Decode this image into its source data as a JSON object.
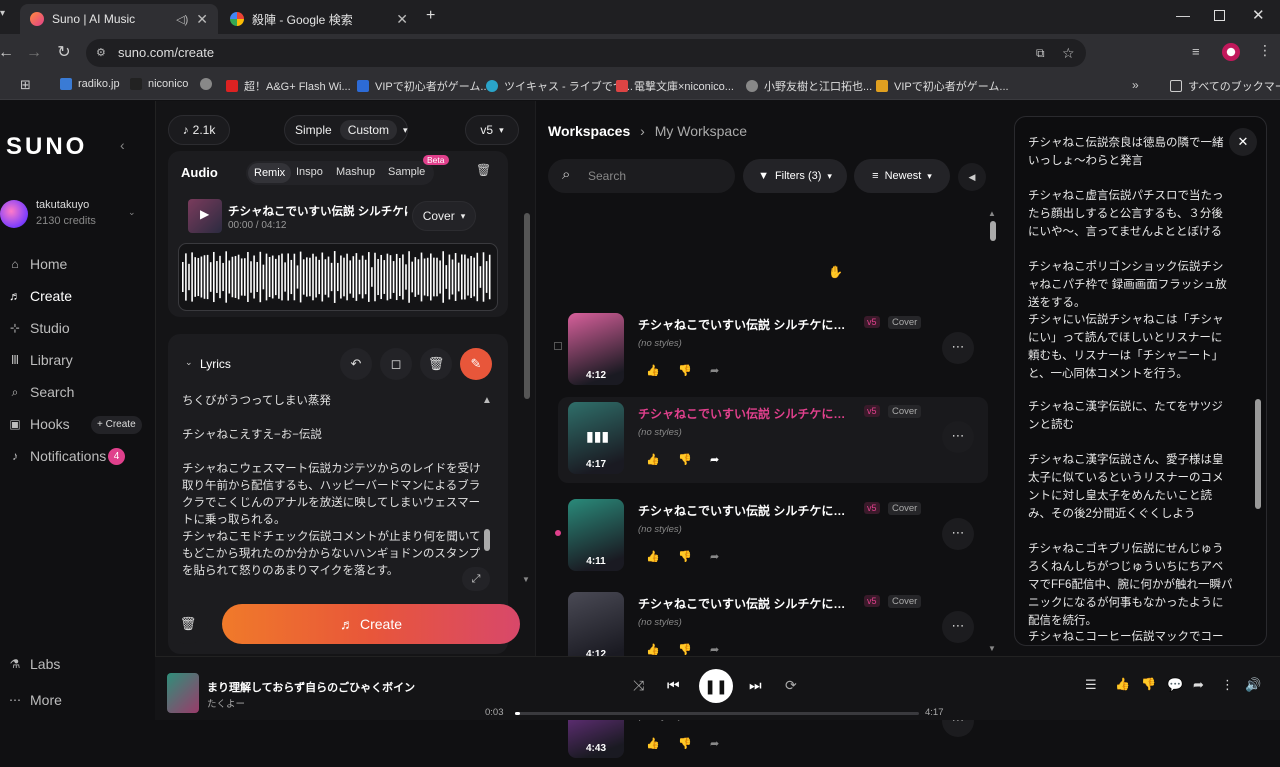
{
  "browser": {
    "tabs": [
      {
        "title": "Suno | AI Music",
        "active": true
      },
      {
        "title": "殺陣 - Google 検索",
        "active": false
      }
    ],
    "url": "suno.com/create",
    "bookmarks": [
      "radiko.jp",
      "niconico",
      "超！A&G+ Flash Wi...",
      "VIPで初心者がゲーム...",
      "ツイキャス - ライブでつ...",
      "電撃文庫×niconico...",
      "小野友樹と江口拓也...",
      "VIPで初心者がゲーム..."
    ],
    "bookmarks_folder": "すべてのブックマーク"
  },
  "sidebar": {
    "logo": "SUNO",
    "user": {
      "name": "takutakuyo",
      "credits": "2130 credits"
    },
    "items": [
      {
        "label": "Home",
        "icon": "home-icon"
      },
      {
        "label": "Create",
        "icon": "create-icon",
        "active": true
      },
      {
        "label": "Studio",
        "icon": "studio-icon"
      },
      {
        "label": "Library",
        "icon": "library-icon"
      },
      {
        "label": "Search",
        "icon": "search-icon"
      },
      {
        "label": "Hooks",
        "icon": "hooks-icon"
      },
      {
        "label": "Notifications",
        "icon": "bell-icon"
      }
    ],
    "hooks_create": "+ Create",
    "notifications_badge": "4",
    "bottom": [
      {
        "label": "Labs",
        "icon": "labs-icon"
      },
      {
        "label": "More",
        "icon": "more-icon"
      }
    ]
  },
  "create_panel": {
    "count": "2.1k",
    "mode_simple": "Simple",
    "mode_custom": "Custom",
    "model": "v5",
    "audio_label": "Audio",
    "audio_tabs": [
      "Remix",
      "Inspo",
      "Mashup",
      "Sample"
    ],
    "beta": "Beta",
    "track_title": "チシャねこでいすい伝説 シルチケにつ...",
    "track_time": "00:00 / 04:12",
    "cover_label": "Cover",
    "lyrics_label": "Lyrics",
    "lyrics_lines": [
      "ちくびがうつってしまい蒸発",
      "チシャねこえすえ−お−伝説",
      "チシャねこウェスマート伝説カジテツからのレイドを受け取り午前から配信するも、ハッピーバードマンによるブラクラでこくじんのアナルを放送に映してしまいウェスマートに乗っ取られる。",
      "チシャねこモドチェック伝説コメントが止まり何を聞いてもどこから現れたのか分からないハンギョドンのスタンプを貼られて怒りのあまりマイクを落とす。"
    ],
    "create_button": "Create"
  },
  "workspace": {
    "breadcrumb_root": "Workspaces",
    "breadcrumb_current": "My Workspace",
    "search_placeholder": "Search",
    "filters": "Filters (3)",
    "sort": "Newest",
    "songs": [
      {
        "title": "チシャねこでいすい伝説 シルチケについてあま...",
        "version": "v5",
        "type": "Cover",
        "styles": "(no styles)",
        "duration": "4:12",
        "color": "#d7609b",
        "highlight": false
      },
      {
        "title": "チシャねこでいすい伝説 シルチケについてあ...",
        "version": "v5",
        "type": "Cover",
        "styles": "(no styles)",
        "duration": "4:17",
        "color": "#2f6f6a",
        "highlight": true
      },
      {
        "title": "チシャねこでいすい伝説 シルチケについてあま...",
        "version": "v5",
        "type": "Cover",
        "styles": "(no styles)",
        "duration": "4:11",
        "color": "#2a8a7a",
        "highlight": false
      },
      {
        "title": "チシャねこでいすい伝説 シルチケについてあま...",
        "version": "v5",
        "type": "Cover",
        "styles": "(no styles)",
        "duration": "4:12",
        "color": "#4a4a55",
        "highlight": false
      },
      {
        "title": "チシャねこでいすい伝説 シルチケについてあま...",
        "version": "v5",
        "type": "Cover",
        "styles": "(no styles)",
        "duration": "4:43",
        "color": "#8a3aa8",
        "highlight": false
      }
    ]
  },
  "lyric_panel": {
    "paragraphs": [
      "チシャねこ伝説奈良は徳島の隣で一緒いっしょ〜わらと発言",
      "チシャねこ虚言伝説パチスロで当たったら顔出しすると公言するも、３分後にいや〜、言ってませんよととぼける",
      "チシャねこポリゴンショック伝説チシャねこパチ枠で 録画画面フラッシュ放送をする。",
      "チシャにい伝説チシャねこは「チシャにい」って読んでほしいとリスナーに頼むも、リスナーは「チシャニート」と、一心同体コメントを行う。",
      "チシャねこ漢字伝説に、たてをサツジンと読む",
      "チシャねこ漢字伝説さん、愛子様は皇太子に似ているというリスナーのコメントに対し皇太子をめんたいこと読み、その後2分間近くぐくしよう",
      "チシャねこゴキブリ伝説にせんじゅうろくねんしちがつじゅういちにちアベマでFF6配信中、腕に何かが触れ一瞬パニックになるが何事もなかったように配信を続行。",
      "チシャねこコーヒー伝説マックでコーヒーを頼"
    ]
  },
  "player": {
    "title": "まり理解しておらず自らのごひゃくボイン",
    "artist": "たくよー",
    "current": "0:03",
    "total": "4:17",
    "progress": 0.012
  }
}
